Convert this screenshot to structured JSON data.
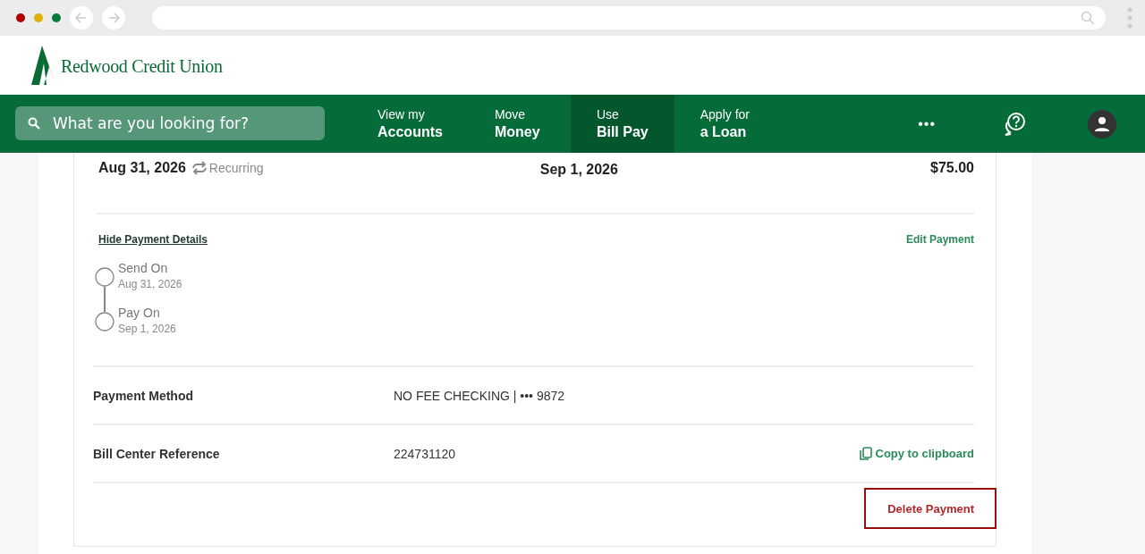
{
  "brand": {
    "name": "Redwood Credit Union"
  },
  "search": {
    "placeholder": "What are you looking for?"
  },
  "nav": [
    {
      "top": "View my",
      "bottom": "Accounts",
      "selected": false
    },
    {
      "top": "Move",
      "bottom": "Money",
      "selected": false
    },
    {
      "top": "Use",
      "bottom": "Bill Pay",
      "selected": true
    },
    {
      "top": "Apply for",
      "bottom": "a Loan",
      "selected": false
    }
  ],
  "more": "•••",
  "summary": {
    "send_date": "Aug 31, 2026",
    "recurring": "Recurring",
    "deliver_date": "Sep 1, 2026",
    "amount": "$75.00"
  },
  "details_link": "Hide Payment Details",
  "edit_link": "Edit Payment",
  "timeline": [
    {
      "label": "Send On",
      "date": "Aug 31, 2026"
    },
    {
      "label": "Pay On",
      "date": "Sep 1, 2026"
    }
  ],
  "rows": [
    {
      "label": "Payment Method",
      "value": "NO FEE CHECKING | ••• 9872"
    },
    {
      "label": "Bill Center Reference",
      "value": "224731120",
      "action": "Copy to clipboard"
    }
  ],
  "delete": {
    "label": "Delete Payment",
    "highlighted": true
  }
}
